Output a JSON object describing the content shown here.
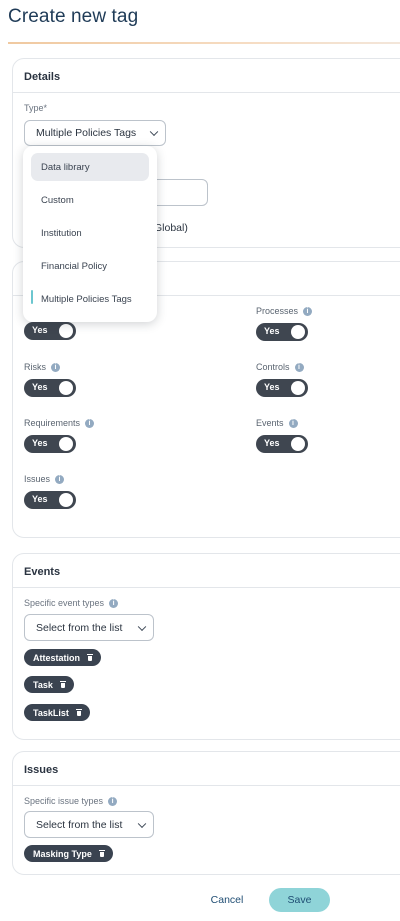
{
  "page": {
    "title": "Create new tag"
  },
  "details": {
    "header": "Details",
    "type_label": "Type*",
    "type_value": "Multiple Policies Tags",
    "partial_text": "Global)"
  },
  "type_dropdown": {
    "options": [
      {
        "label": "Data library",
        "state": "hover"
      },
      {
        "label": "Custom",
        "state": "normal"
      },
      {
        "label": "Institution",
        "state": "normal"
      },
      {
        "label": "Financial Policy",
        "state": "normal"
      },
      {
        "label": "Multiple Policies Tags",
        "state": "selected"
      }
    ]
  },
  "scope": {
    "toggles": [
      {
        "label": "",
        "value": "Yes",
        "has_info": false
      },
      {
        "label": "Processes",
        "value": "Yes",
        "has_info": true
      },
      {
        "label": "Risks",
        "value": "Yes",
        "has_info": true
      },
      {
        "label": "Controls",
        "value": "Yes",
        "has_info": true
      },
      {
        "label": "Requirements",
        "value": "Yes",
        "has_info": true
      },
      {
        "label": "Events",
        "value": "Yes",
        "has_info": true
      },
      {
        "label": "Issues",
        "value": "Yes",
        "has_info": true
      }
    ]
  },
  "events": {
    "header": "Events",
    "field_label": "Specific event types",
    "select_placeholder": "Select from the list",
    "chips": [
      "Attestation",
      "Task",
      "TaskList"
    ]
  },
  "issues": {
    "header": "Issues",
    "field_label": "Specific issue types",
    "select_placeholder": "Select from the list",
    "chips": [
      "Masking Type"
    ]
  },
  "footer": {
    "cancel_label": "Cancel",
    "save_label": "Save"
  },
  "colors": {
    "accent": "#8fd4d8",
    "toggle_on": "#3f4650",
    "chip": "#3a4350",
    "title": "#1f3b57"
  }
}
